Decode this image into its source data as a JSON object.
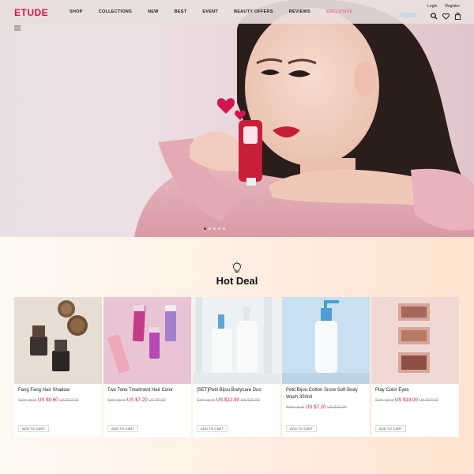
{
  "brand": {
    "logo": "ETUDE",
    "color": "#d6134d"
  },
  "nav": {
    "items": [
      "SHOP",
      "COLLECTIONS",
      "NEW",
      "BEST",
      "EVENT",
      "BEAUTY OFFERS",
      "REVIEWS",
      "EXCLUSIVE"
    ]
  },
  "auth": {
    "login": "Login",
    "register": "Register"
  },
  "icons": {
    "menu": "menu-icon",
    "search": "search-icon",
    "wishlist": "heart-icon",
    "cart": "bag-icon"
  },
  "hero": {
    "slides": 5,
    "active_slide": 1
  },
  "hot_deal": {
    "title": "Hot Deal",
    "icon": "lightbulb-icon",
    "add_to_cart": "ADD TO CART",
    "products": [
      {
        "name": "Fang Fang Hair Shadow",
        "price_prefix": "Sale up to",
        "sale": "US $9.60",
        "original": "US $12.00"
      },
      {
        "name": "Two Tone Treatment Hair Color",
        "price_prefix": "Sale up to",
        "sale": "US $7.20",
        "original": "US $9.00"
      },
      {
        "name": "[SET]Petit Bijou Bodycare Duo",
        "price_prefix": "Sale up to",
        "sale": "US $12.90",
        "original": "US $21.50"
      },
      {
        "name": "Petit Bijou Cotton Snow Soft Body Wash 300ml",
        "price_prefix": "Sale up to",
        "sale": "US $7.20",
        "original": "US $10.00"
      },
      {
        "name": "Play Color Eyes",
        "price_prefix": "Sale up to",
        "sale": "US $14.00",
        "original": "US $20.00"
      }
    ]
  }
}
